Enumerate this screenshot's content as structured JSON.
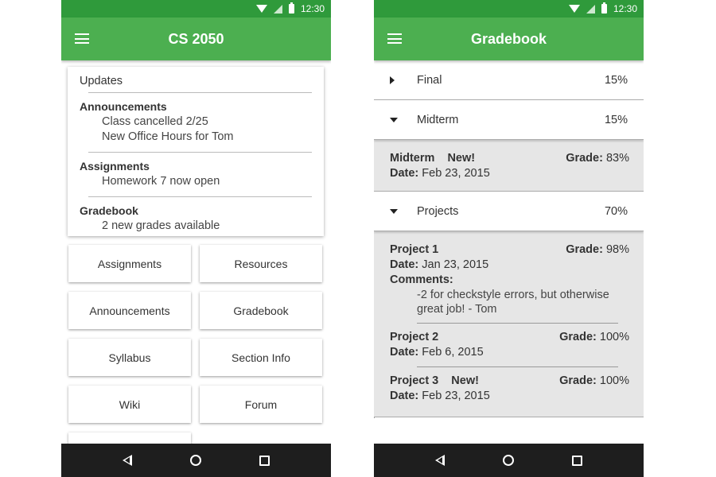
{
  "status_bar": {
    "time": "12:30"
  },
  "left": {
    "title": "CS 2050",
    "updates": {
      "title": "Updates",
      "sections": [
        {
          "heading": "Announcements",
          "items": [
            "Class cancelled 2/25",
            "New Office Hours for Tom"
          ]
        },
        {
          "heading": "Assignments",
          "items": [
            "Homework 7 now open"
          ]
        },
        {
          "heading": "Gradebook",
          "items": [
            "2 new grades available"
          ]
        }
      ]
    },
    "buttons": [
      "Assignments",
      "Resources",
      "Announcements",
      "Gradebook",
      "Syllabus",
      "Section Info",
      "Wiki",
      "Forum"
    ]
  },
  "right": {
    "title": "Gradebook",
    "final": {
      "name": "Final",
      "pct": "15%"
    },
    "midterm": {
      "name": "Midterm",
      "pct": "15%"
    },
    "midterm_detail": {
      "name": "Midterm",
      "new": "New!",
      "grade_label": "Grade:",
      "grade": "83%",
      "date_label": "Date:",
      "date": "Feb 23, 2015"
    },
    "projects": {
      "name": "Projects",
      "pct": "70%"
    },
    "project_items": [
      {
        "name": "Project 1",
        "new": "",
        "grade_label": "Grade:",
        "grade": "98%",
        "date_label": "Date:",
        "date": "Jan 23, 2015",
        "comments_label": "Comments:",
        "comment_line1": "-2 for checkstyle errors, but otherwise",
        "comment_line2": "great job!   - Tom"
      },
      {
        "name": "Project 2",
        "new": "",
        "grade_label": "Grade:",
        "grade": "100%",
        "date_label": "Date:",
        "date": "Feb 6, 2015"
      },
      {
        "name": "Project 3",
        "new": "New!",
        "grade_label": "Grade:",
        "grade": "100%",
        "date_label": "Date:",
        "date": "Feb 23, 2015"
      }
    ]
  },
  "colors": {
    "status_bar": "#2f9a3b",
    "app_bar": "#4caf50",
    "nav_bar": "#1e1e1e",
    "detail_bg": "#e6e6e6"
  },
  "icons": [
    "wifi-icon",
    "signal-icon",
    "battery-icon",
    "menu-icon",
    "back-icon",
    "home-icon",
    "recents-icon",
    "expand-arrow-icon",
    "collapse-arrow-icon"
  ]
}
